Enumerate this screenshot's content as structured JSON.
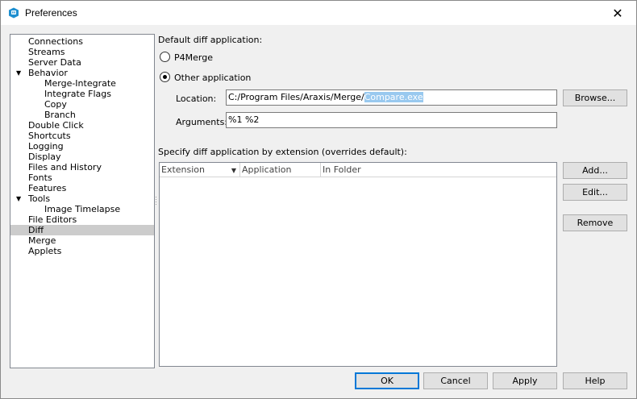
{
  "window": {
    "title": "Preferences",
    "close_glyph": "✕"
  },
  "tree": {
    "items": [
      {
        "label": "Connections"
      },
      {
        "label": "Streams"
      },
      {
        "label": "Server Data"
      },
      {
        "label": "Behavior"
      },
      {
        "label": "Merge-Integrate"
      },
      {
        "label": "Integrate Flags"
      },
      {
        "label": "Copy"
      },
      {
        "label": "Branch"
      },
      {
        "label": "Double Click"
      },
      {
        "label": "Shortcuts"
      },
      {
        "label": "Logging"
      },
      {
        "label": "Display"
      },
      {
        "label": "Files and History"
      },
      {
        "label": "Fonts"
      },
      {
        "label": "Features"
      },
      {
        "label": "Tools"
      },
      {
        "label": "Image Timelapse"
      },
      {
        "label": "File Editors"
      },
      {
        "label": "Diff"
      },
      {
        "label": "Merge"
      },
      {
        "label": "Applets"
      }
    ],
    "selected": "Diff"
  },
  "default_diff": {
    "heading": "Default diff application:",
    "p4merge_label": "P4Merge",
    "other_label": "Other application",
    "selected_option": "Other application",
    "location_label": "Location:",
    "location_path": "C:/Program Files/Araxis/Merge/",
    "location_file": "Compare.exe",
    "arguments_label": "Arguments:",
    "arguments_value": "%1 %2",
    "browse_label": "Browse..."
  },
  "extensions": {
    "heading": "Specify diff application by extension (overrides default):",
    "columns": [
      "Extension",
      "Application",
      "In Folder"
    ],
    "rows": [],
    "add_label": "Add...",
    "edit_label": "Edit...",
    "remove_label": "Remove"
  },
  "footer": {
    "ok_label": "OK",
    "cancel_label": "Cancel",
    "apply_label": "Apply",
    "help_label": "Help"
  },
  "colors": {
    "accent": "#0078d7",
    "selection": "#cccccc",
    "text_selection": "#99c9ef"
  },
  "icons": {
    "app": "p4v-app-icon",
    "expand": "expand-arrow-icon",
    "sort": "sort-down-icon"
  }
}
